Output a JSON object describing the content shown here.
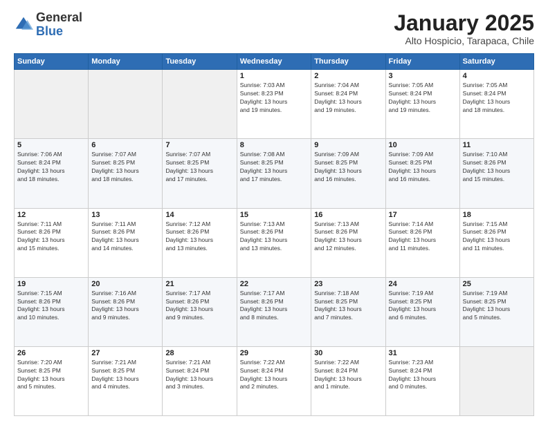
{
  "logo": {
    "general": "General",
    "blue": "Blue"
  },
  "header": {
    "month": "January 2025",
    "location": "Alto Hospicio, Tarapaca, Chile"
  },
  "weekdays": [
    "Sunday",
    "Monday",
    "Tuesday",
    "Wednesday",
    "Thursday",
    "Friday",
    "Saturday"
  ],
  "weeks": [
    [
      {
        "day": "",
        "info": ""
      },
      {
        "day": "",
        "info": ""
      },
      {
        "day": "",
        "info": ""
      },
      {
        "day": "1",
        "info": "Sunrise: 7:03 AM\nSunset: 8:23 PM\nDaylight: 13 hours\nand 19 minutes."
      },
      {
        "day": "2",
        "info": "Sunrise: 7:04 AM\nSunset: 8:24 PM\nDaylight: 13 hours\nand 19 minutes."
      },
      {
        "day": "3",
        "info": "Sunrise: 7:05 AM\nSunset: 8:24 PM\nDaylight: 13 hours\nand 19 minutes."
      },
      {
        "day": "4",
        "info": "Sunrise: 7:05 AM\nSunset: 8:24 PM\nDaylight: 13 hours\nand 18 minutes."
      }
    ],
    [
      {
        "day": "5",
        "info": "Sunrise: 7:06 AM\nSunset: 8:24 PM\nDaylight: 13 hours\nand 18 minutes."
      },
      {
        "day": "6",
        "info": "Sunrise: 7:07 AM\nSunset: 8:25 PM\nDaylight: 13 hours\nand 18 minutes."
      },
      {
        "day": "7",
        "info": "Sunrise: 7:07 AM\nSunset: 8:25 PM\nDaylight: 13 hours\nand 17 minutes."
      },
      {
        "day": "8",
        "info": "Sunrise: 7:08 AM\nSunset: 8:25 PM\nDaylight: 13 hours\nand 17 minutes."
      },
      {
        "day": "9",
        "info": "Sunrise: 7:09 AM\nSunset: 8:25 PM\nDaylight: 13 hours\nand 16 minutes."
      },
      {
        "day": "10",
        "info": "Sunrise: 7:09 AM\nSunset: 8:25 PM\nDaylight: 13 hours\nand 16 minutes."
      },
      {
        "day": "11",
        "info": "Sunrise: 7:10 AM\nSunset: 8:26 PM\nDaylight: 13 hours\nand 15 minutes."
      }
    ],
    [
      {
        "day": "12",
        "info": "Sunrise: 7:11 AM\nSunset: 8:26 PM\nDaylight: 13 hours\nand 15 minutes."
      },
      {
        "day": "13",
        "info": "Sunrise: 7:11 AM\nSunset: 8:26 PM\nDaylight: 13 hours\nand 14 minutes."
      },
      {
        "day": "14",
        "info": "Sunrise: 7:12 AM\nSunset: 8:26 PM\nDaylight: 13 hours\nand 13 minutes."
      },
      {
        "day": "15",
        "info": "Sunrise: 7:13 AM\nSunset: 8:26 PM\nDaylight: 13 hours\nand 13 minutes."
      },
      {
        "day": "16",
        "info": "Sunrise: 7:13 AM\nSunset: 8:26 PM\nDaylight: 13 hours\nand 12 minutes."
      },
      {
        "day": "17",
        "info": "Sunrise: 7:14 AM\nSunset: 8:26 PM\nDaylight: 13 hours\nand 11 minutes."
      },
      {
        "day": "18",
        "info": "Sunrise: 7:15 AM\nSunset: 8:26 PM\nDaylight: 13 hours\nand 11 minutes."
      }
    ],
    [
      {
        "day": "19",
        "info": "Sunrise: 7:15 AM\nSunset: 8:26 PM\nDaylight: 13 hours\nand 10 minutes."
      },
      {
        "day": "20",
        "info": "Sunrise: 7:16 AM\nSunset: 8:26 PM\nDaylight: 13 hours\nand 9 minutes."
      },
      {
        "day": "21",
        "info": "Sunrise: 7:17 AM\nSunset: 8:26 PM\nDaylight: 13 hours\nand 9 minutes."
      },
      {
        "day": "22",
        "info": "Sunrise: 7:17 AM\nSunset: 8:26 PM\nDaylight: 13 hours\nand 8 minutes."
      },
      {
        "day": "23",
        "info": "Sunrise: 7:18 AM\nSunset: 8:25 PM\nDaylight: 13 hours\nand 7 minutes."
      },
      {
        "day": "24",
        "info": "Sunrise: 7:19 AM\nSunset: 8:25 PM\nDaylight: 13 hours\nand 6 minutes."
      },
      {
        "day": "25",
        "info": "Sunrise: 7:19 AM\nSunset: 8:25 PM\nDaylight: 13 hours\nand 5 minutes."
      }
    ],
    [
      {
        "day": "26",
        "info": "Sunrise: 7:20 AM\nSunset: 8:25 PM\nDaylight: 13 hours\nand 5 minutes."
      },
      {
        "day": "27",
        "info": "Sunrise: 7:21 AM\nSunset: 8:25 PM\nDaylight: 13 hours\nand 4 minutes."
      },
      {
        "day": "28",
        "info": "Sunrise: 7:21 AM\nSunset: 8:24 PM\nDaylight: 13 hours\nand 3 minutes."
      },
      {
        "day": "29",
        "info": "Sunrise: 7:22 AM\nSunset: 8:24 PM\nDaylight: 13 hours\nand 2 minutes."
      },
      {
        "day": "30",
        "info": "Sunrise: 7:22 AM\nSunset: 8:24 PM\nDaylight: 13 hours\nand 1 minute."
      },
      {
        "day": "31",
        "info": "Sunrise: 7:23 AM\nSunset: 8:24 PM\nDaylight: 13 hours\nand 0 minutes."
      },
      {
        "day": "",
        "info": ""
      }
    ]
  ]
}
